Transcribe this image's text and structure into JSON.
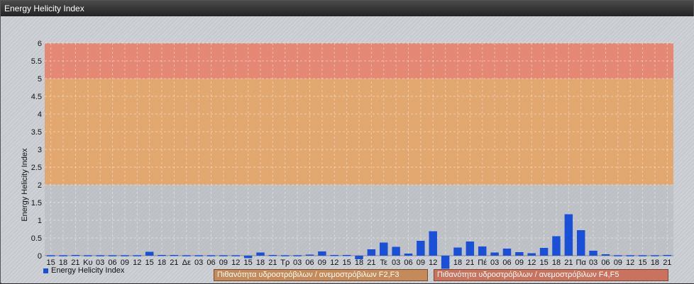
{
  "window": {
    "title": "Energy Helicity Index"
  },
  "colors": {
    "bar": "#1a4fd8",
    "band_low": "#b4b8bb",
    "band_mid": "#e4a46a",
    "band_high": "#e68570"
  },
  "legend": {
    "label": "Energy Helicity Index"
  },
  "bands": [
    {
      "label": "Πιθανότητα υδροστρόβιλων / ανεμοστρόβιλων F2,F3",
      "from": 2,
      "to": 5
    },
    {
      "label": "Πιθανότητα υδροστρόβιλων / ανεμοστρόβιλων F4,F5",
      "from": 5,
      "to": 6
    }
  ],
  "chart_data": {
    "type": "bar",
    "title": "",
    "xlabel": "",
    "ylabel": "Energy Helicity Index",
    "ylim": [
      0,
      6
    ],
    "yticks": [
      "0",
      "0.5",
      "1",
      "1.5",
      "2",
      "2.5",
      "3",
      "3.5",
      "4",
      "4.5",
      "5",
      "5.5",
      "6"
    ],
    "grid": true,
    "legend_position": "bottom-left",
    "categories": [
      "15",
      "18",
      "21",
      "Κυ",
      "03",
      "06",
      "09",
      "12",
      "15",
      "18",
      "21",
      "Δε",
      "03",
      "06",
      "09",
      "12",
      "15",
      "18",
      "21",
      "Τρ",
      "03",
      "06",
      "09",
      "12",
      "15",
      "18",
      "21",
      "Τε",
      "03",
      "06",
      "09",
      "12",
      "15",
      "18",
      "21",
      "Πέ",
      "03",
      "06",
      "09",
      "12",
      "15",
      "18",
      "21",
      "Πα",
      "03",
      "06",
      "09",
      "12",
      "15",
      "18",
      "21"
    ],
    "series": [
      {
        "name": "Energy Helicity Index",
        "values": [
          0.01,
          0.01,
          0.02,
          0.01,
          0.01,
          0.01,
          0.01,
          0.01,
          0.11,
          0.02,
          0.02,
          0.01,
          0.01,
          0.01,
          0.01,
          0.01,
          -0.07,
          0.09,
          0.02,
          0.01,
          0.01,
          0.03,
          0.12,
          0.02,
          0.02,
          -0.1,
          0.18,
          0.37,
          0.25,
          0.06,
          0.42,
          0.69,
          -0.37,
          0.23,
          0.4,
          0.26,
          0.09,
          0.2,
          0.1,
          0.07,
          0.22,
          0.55,
          1.17,
          0.72,
          0.14,
          0.04,
          0.01,
          0.01,
          0.01,
          0.01,
          0.02
        ]
      }
    ]
  }
}
